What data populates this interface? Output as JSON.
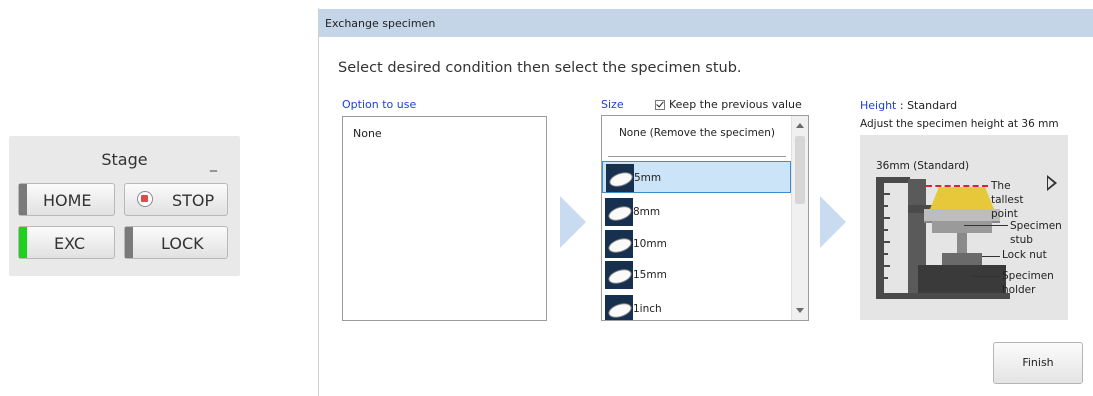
{
  "stage_panel": {
    "title": "Stage",
    "minimize_glyph": "_",
    "buttons": {
      "home": "HOME",
      "stop": "STOP",
      "exc": "EXC",
      "lock": "LOCK"
    },
    "exc_indicator_color": "#1dd11d"
  },
  "dialog": {
    "title": "Exchange specimen",
    "instruction": "Select desired condition then select the specimen stub.",
    "option_column": {
      "label": "Option to use",
      "items": [
        "None"
      ]
    },
    "size_column": {
      "label": "Size",
      "keep_previous_label": "Keep the previous value",
      "keep_previous_checked": true,
      "none_item": "None (Remove the specimen)",
      "items": [
        "5mm",
        "8mm",
        "10mm",
        "15mm",
        "1inch"
      ],
      "selected": "5mm"
    },
    "height_column": {
      "label": "Height",
      "value": "Standard",
      "adjust_text": "Adjust the specimen height at 36 mm",
      "diagram": {
        "caption": "36mm (Standard)",
        "tallest_point": "The tallest point",
        "specimen_stub": "Specimen stub",
        "lock_nut": "Lock nut",
        "specimen_holder": "Specimen holder"
      }
    },
    "finish_label": "Finish",
    "header_color": "#c4d5e8",
    "accent_color": "#1a3fd6"
  }
}
